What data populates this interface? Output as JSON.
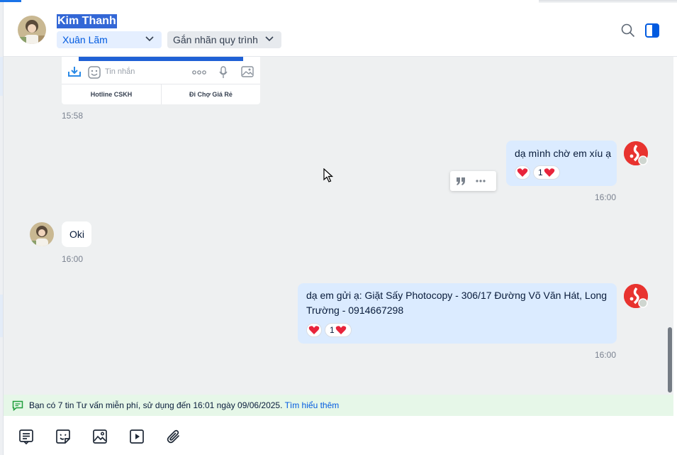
{
  "header": {
    "contact_name": "Kim Thanh",
    "owner_dropdown": "Xuân Lãm",
    "tag_dropdown": "Gắn nhãn quy trình",
    "icons": [
      "search-icon",
      "side-panel-icon"
    ]
  },
  "preview_card": {
    "placeholder": "Tin nhắn",
    "buttons": [
      "Hotline CSKH",
      "Đi Chợ Giá Rẻ"
    ],
    "time": "15:58"
  },
  "messages": [
    {
      "direction": "out",
      "text": "dạ mình chờ em xíu ạ",
      "reaction_count": "1",
      "time": "16:00"
    },
    {
      "direction": "in",
      "text": "Oki",
      "time": "16:00"
    },
    {
      "direction": "out",
      "text": "dạ em gửi ạ: Giặt Sấy Photocopy - 306/17 Đường Võ Văn Hát, Long Trường - 0914667298",
      "reaction_count": "1",
      "time": "16:00"
    }
  ],
  "notice": {
    "text": "Bạn có 7 tin Tư vấn miễn phí, sử dụng đến 16:01 ngày 09/06/2025.",
    "link": "Tìm hiểu thêm"
  },
  "colors": {
    "accent": "#005ae0",
    "bubble_out": "#dbebff",
    "heart": "#e8243b",
    "notice_bg": "#e6f7e8"
  }
}
